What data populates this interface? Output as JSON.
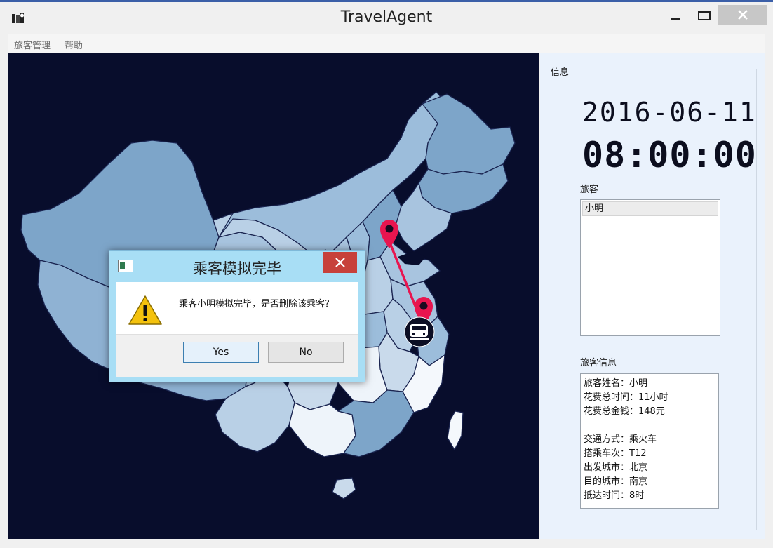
{
  "window": {
    "title": "TravelAgent"
  },
  "menu": {
    "items": [
      "旅客管理",
      "帮助"
    ]
  },
  "info": {
    "group_title": "信息",
    "date": "2016-06-11",
    "time": "08:00:00",
    "passengers_label": "旅客",
    "passengers": [
      "小明"
    ],
    "passenger_info_label": "旅客信息",
    "info_lines": [
      "旅客姓名：小明",
      "花费总时间：11小时",
      "花费总金钱：148元",
      "",
      "交通方式：乘火车",
      "搭乘车次：T12",
      "出发城市：北京",
      "目的城市：南京",
      "抵达时间：8时"
    ]
  },
  "dialog": {
    "title": "乘客模拟完毕",
    "message": "乘客小明模拟完毕，是否删除该乘客？",
    "yes_label": "Yes",
    "no_label": "No"
  },
  "icons": {
    "app": "map-app-icon",
    "close": "close-icon",
    "warning": "warning-icon",
    "origin": "map-pin-icon",
    "vehicle": "train-icon"
  },
  "colors": {
    "map_background": "#080d2c",
    "route": "#e8154f",
    "dialog_frame": "#a8def5",
    "close_button": "#c7413b"
  }
}
